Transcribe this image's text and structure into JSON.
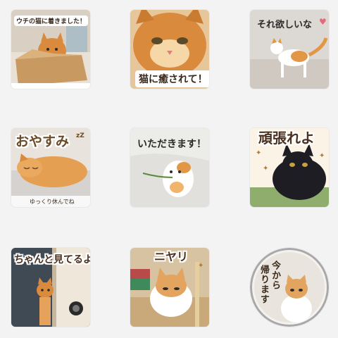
{
  "stickers": [
    {
      "id": "box-cat",
      "caption": "ウチの猫に着きました！"
    },
    {
      "id": "healed-cat",
      "caption": "猫に癒されて！"
    },
    {
      "id": "want-cat",
      "caption": "それ欲しいな",
      "accent": "♥"
    },
    {
      "id": "sleep-cat",
      "caption": "おやすみ",
      "caption_suffix": "zZ",
      "sub_caption": "ゆっくり休んでね"
    },
    {
      "id": "itadakimasu-cat",
      "caption": "いただきます！"
    },
    {
      "id": "ganbare-cat",
      "caption": "頑張れよ"
    },
    {
      "id": "watching-cat",
      "caption": "ちゃんと見てるよ！"
    },
    {
      "id": "smirk-cat",
      "caption": "ニヤリ"
    },
    {
      "id": "going-home-cat",
      "caption_line1": "今から",
      "caption_line2": "帰ります"
    }
  ],
  "colors": {
    "background": "#f3f3f4",
    "orange_cat": "#d98a3d",
    "orange_cat_light": "#f0b46a",
    "black_cat": "#1f1d24",
    "cream": "#fff6e6",
    "caption_text": "#3a2a1c",
    "heart": "#e5697a"
  }
}
